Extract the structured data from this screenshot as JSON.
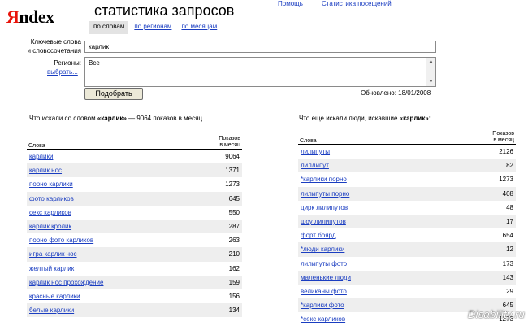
{
  "logo": {
    "first": "Я",
    "rest": "ndex"
  },
  "page_title": "статистика запросов",
  "top_links": {
    "help": "Помощь",
    "visits": "Статистика посещений"
  },
  "tabs": [
    {
      "label": "по словам",
      "active": true
    },
    {
      "label": "по регионам",
      "active": false
    },
    {
      "label": "по месяцам",
      "active": false
    }
  ],
  "form": {
    "keywords_label_1": "Ключевые слова",
    "keywords_label_2": "и словосочетания",
    "keywords_value": "карлик",
    "regions_label": "Регионы:",
    "regions_link": "выбрать...",
    "regions_value": "Все",
    "submit_label": "Подобрать",
    "updated": "Обновлено: 18/01/2008"
  },
  "left": {
    "heading_pre": "Что искали со словом ",
    "heading_word": "«карлик»",
    "heading_post": " — 9064 показов в месяц.",
    "col_words": "Слова",
    "col_shows_1": "Показов",
    "col_shows_2": "в месяц",
    "rows": [
      {
        "word": "карлики",
        "count": "9064"
      },
      {
        "word": "карлик нос",
        "count": "1371"
      },
      {
        "word": "порно карлики",
        "count": "1273"
      },
      {
        "word": "фото карликов",
        "count": "645"
      },
      {
        "word": "секс карликов",
        "count": "550"
      },
      {
        "word": "карлик кролик",
        "count": "287"
      },
      {
        "word": "порно фото карликов",
        "count": "263"
      },
      {
        "word": "игра карлик нос",
        "count": "210"
      },
      {
        "word": "желтый карлик",
        "count": "162"
      },
      {
        "word": "карлик нос прохождение",
        "count": "159"
      },
      {
        "word": "красные карлики",
        "count": "156"
      },
      {
        "word": "белые карлики",
        "count": "134"
      }
    ]
  },
  "right": {
    "heading_pre": "Что еще искали люди, искавшие ",
    "heading_word": "«карлик»",
    "heading_post": ":",
    "col_words": "Слова",
    "col_shows_1": "Показов",
    "col_shows_2": "в месяц",
    "rows": [
      {
        "word": "лилипуты",
        "count": "2126"
      },
      {
        "word": "лиллипут",
        "count": "82"
      },
      {
        "word": "*карлики порно",
        "count": "1273"
      },
      {
        "word": "лилипуты порно",
        "count": "408"
      },
      {
        "word": "цирк лилипутов",
        "count": "48"
      },
      {
        "word": "шоу лилипутов",
        "count": "17"
      },
      {
        "word": "форт боярд",
        "count": "654"
      },
      {
        "word": "*люди карлики",
        "count": "12"
      },
      {
        "word": "лилипуты фото",
        "count": "173"
      },
      {
        "word": "маленькие люди",
        "count": "143"
      },
      {
        "word": "великаны фото",
        "count": "29"
      },
      {
        "word": "*карлики фото",
        "count": "645"
      },
      {
        "word": "*секс карликов",
        "count": "1273"
      }
    ]
  },
  "watermark": "Disability.ru"
}
